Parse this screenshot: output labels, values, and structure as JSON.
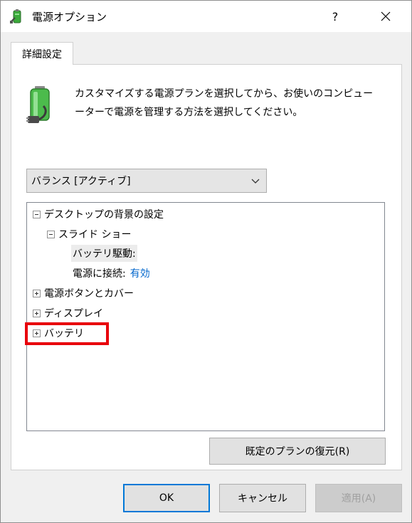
{
  "window": {
    "title": "電源オプション",
    "help_label": "?",
    "icon": "battery-plug-icon"
  },
  "tab": {
    "label": "詳細設定"
  },
  "description": {
    "line1": "カスタマイズする電源プランを選択してから、お使いのコンピュー",
    "line2": "ーターで電源を管理する方法を選択してください。"
  },
  "plan_select": {
    "value": "バランス [アクティブ]"
  },
  "tree": {
    "desktop_background": "デスクトップの背景の設定",
    "slideshow": "スライド ショー",
    "on_battery": "バッテリ駆動:",
    "plugged_in": "電源に接続:",
    "plugged_in_value": "有効",
    "power_buttons": "電源ボタンとカバー",
    "display": "ディスプレイ",
    "battery": "バッテリ"
  },
  "buttons": {
    "restore": "既定のプランの復元(R)",
    "ok": "OK",
    "cancel": "キャンセル",
    "apply": "適用(A)"
  },
  "colors": {
    "highlight_border": "#e8000b",
    "link_value": "#0066cc",
    "ok_border": "#0078d7"
  }
}
